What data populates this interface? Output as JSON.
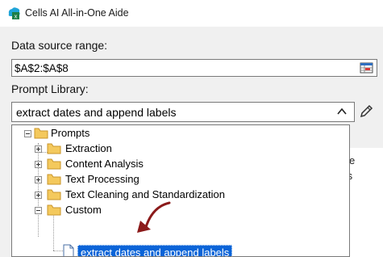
{
  "window": {
    "title": "Cells AI All-in-One Aide"
  },
  "data_source": {
    "label": "Data source range:",
    "value": "$A$2:$A$8"
  },
  "prompt_library": {
    "label": "Prompt Library:",
    "selected": "extract dates and append labels"
  },
  "tree": {
    "root": "Prompts",
    "categories": [
      {
        "label": "Extraction"
      },
      {
        "label": "Content Analysis"
      },
      {
        "label": "Text Processing"
      },
      {
        "label": "Text Cleaning and Standardization"
      },
      {
        "label": "Custom"
      }
    ],
    "custom_child": "extract dates and append labels"
  },
  "colors": {
    "selection": "#0a64d8",
    "folder": "#f2c14e",
    "arrow": "#8b1a1a"
  }
}
